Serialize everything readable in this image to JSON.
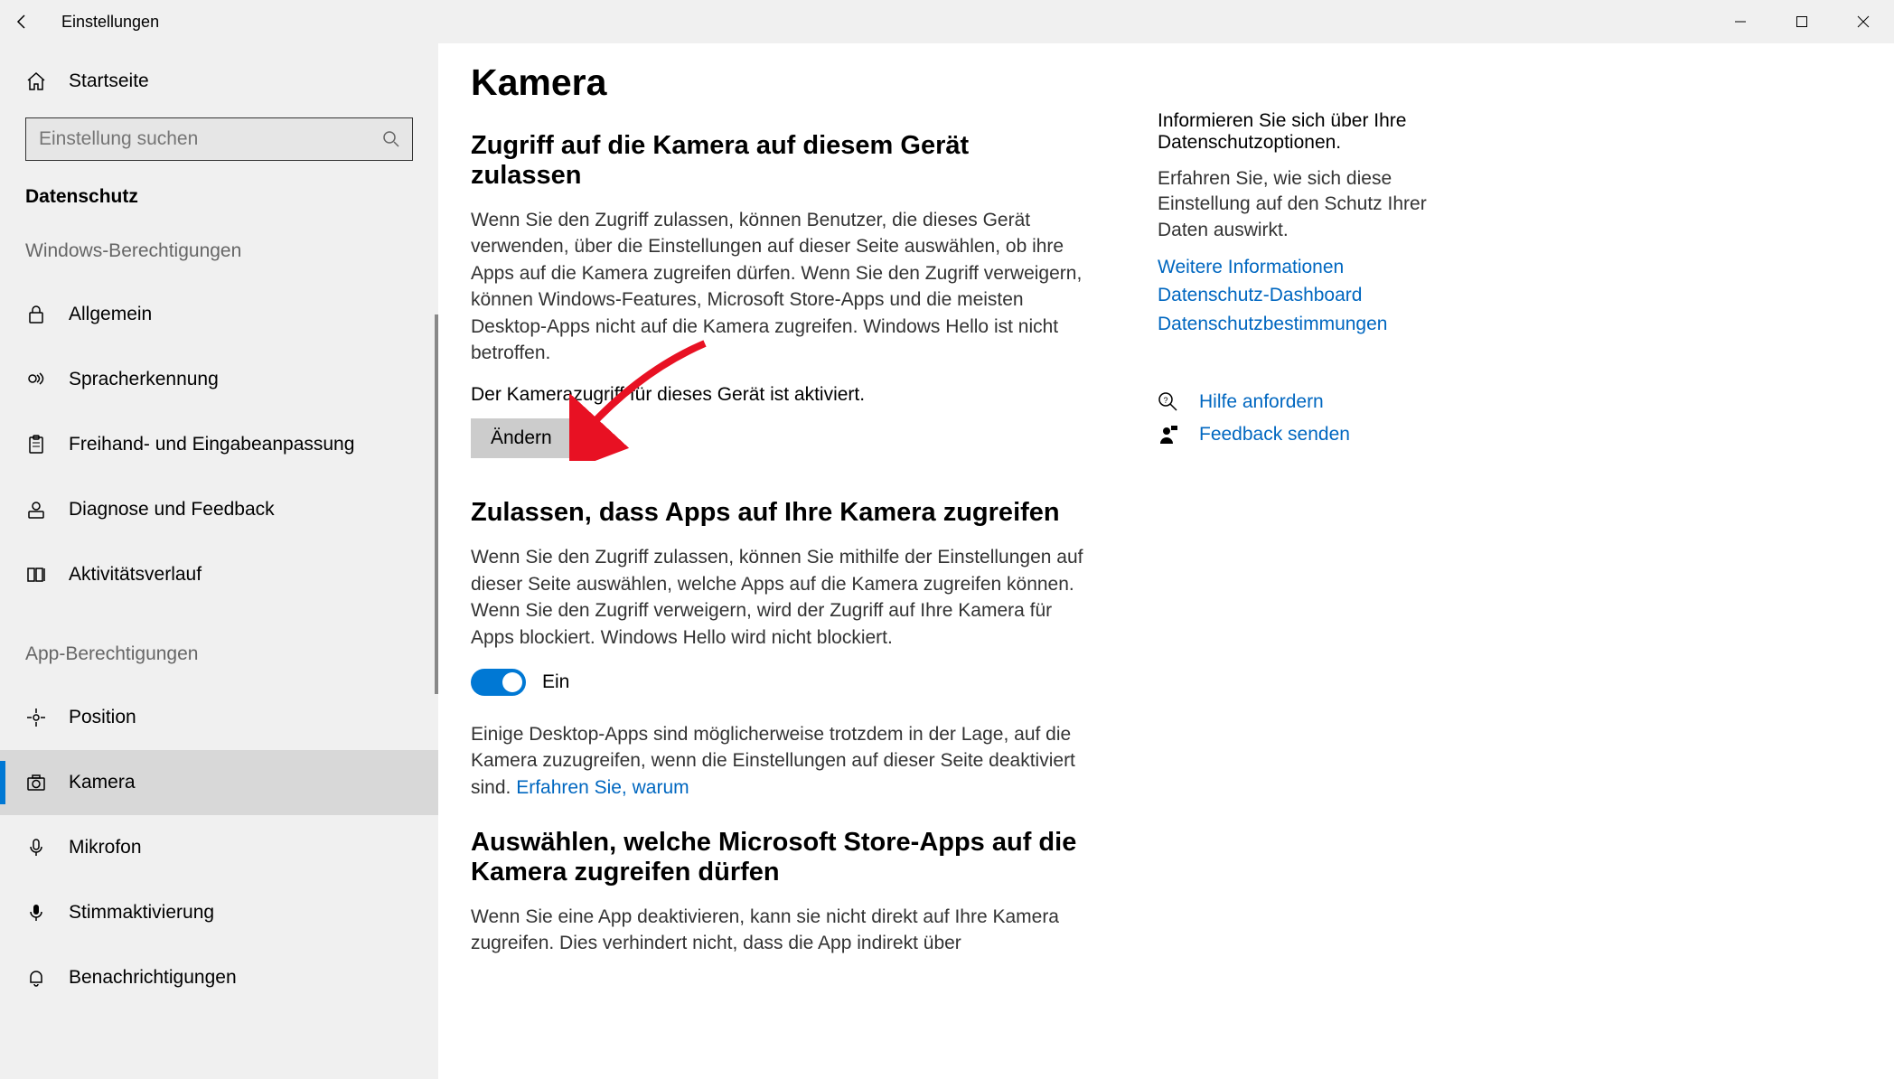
{
  "window": {
    "title": "Einstellungen"
  },
  "sidebar": {
    "home": "Startseite",
    "search_placeholder": "Einstellung suchen",
    "category": "Datenschutz",
    "group_windows": "Windows-Berechtigungen",
    "group_apps": "App-Berechtigungen",
    "items_windows": [
      {
        "label": "Allgemein"
      },
      {
        "label": "Spracherkennung"
      },
      {
        "label": "Freihand- und Eingabeanpassung"
      },
      {
        "label": "Diagnose und Feedback"
      },
      {
        "label": "Aktivitätsverlauf"
      }
    ],
    "items_apps": [
      {
        "label": "Position"
      },
      {
        "label": "Kamera"
      },
      {
        "label": "Mikrofon"
      },
      {
        "label": "Stimmaktivierung"
      },
      {
        "label": "Benachrichtigungen"
      }
    ]
  },
  "content": {
    "page_title": "Kamera",
    "section1_title": "Zugriff auf die Kamera auf diesem Gerät zulassen",
    "section1_text": "Wenn Sie den Zugriff zulassen, können Benutzer, die dieses Gerät verwenden, über die Einstellungen auf dieser Seite auswählen, ob ihre Apps auf die Kamera zugreifen dürfen. Wenn Sie den Zugriff verweigern, können Windows-Features, Microsoft Store-Apps und die meisten Desktop-Apps nicht auf die Kamera zugreifen. Windows Hello ist nicht betroffen.",
    "status": "Der Kamerazugriff für dieses Gerät ist aktiviert.",
    "change_button": "Ändern",
    "section2_title": "Zulassen, dass Apps auf Ihre Kamera zugreifen",
    "section2_text": "Wenn Sie den Zugriff zulassen, können Sie mithilfe der Einstellungen auf dieser Seite auswählen, welche Apps auf die Kamera zugreifen können. Wenn Sie den Zugriff verweigern, wird der Zugriff auf Ihre Kamera für Apps blockiert. Windows Hello wird nicht blockiert.",
    "toggle_label": "Ein",
    "section2_note_a": "Einige Desktop-Apps sind möglicherweise trotzdem in der Lage, auf die Kamera zuzugreifen, wenn die Einstellungen auf dieser Seite deaktiviert sind. ",
    "section2_note_link": "Erfahren Sie, warum",
    "section3_title": "Auswählen, welche Microsoft Store-Apps auf die Kamera zugreifen dürfen",
    "section3_text": "Wenn Sie eine App deaktivieren, kann sie nicht direkt auf Ihre Kamera zugreifen. Dies verhindert nicht, dass die App indirekt über"
  },
  "aside": {
    "heading": "Informieren Sie sich über Ihre Datenschutzoptionen.",
    "text": "Erfahren Sie, wie sich diese Einstellung auf den Schutz Ihrer Daten auswirkt.",
    "link1": "Weitere Informationen",
    "link2": "Datenschutz-Dashboard",
    "link3": "Datenschutzbestimmungen",
    "help": "Hilfe anfordern",
    "feedback": "Feedback senden"
  }
}
